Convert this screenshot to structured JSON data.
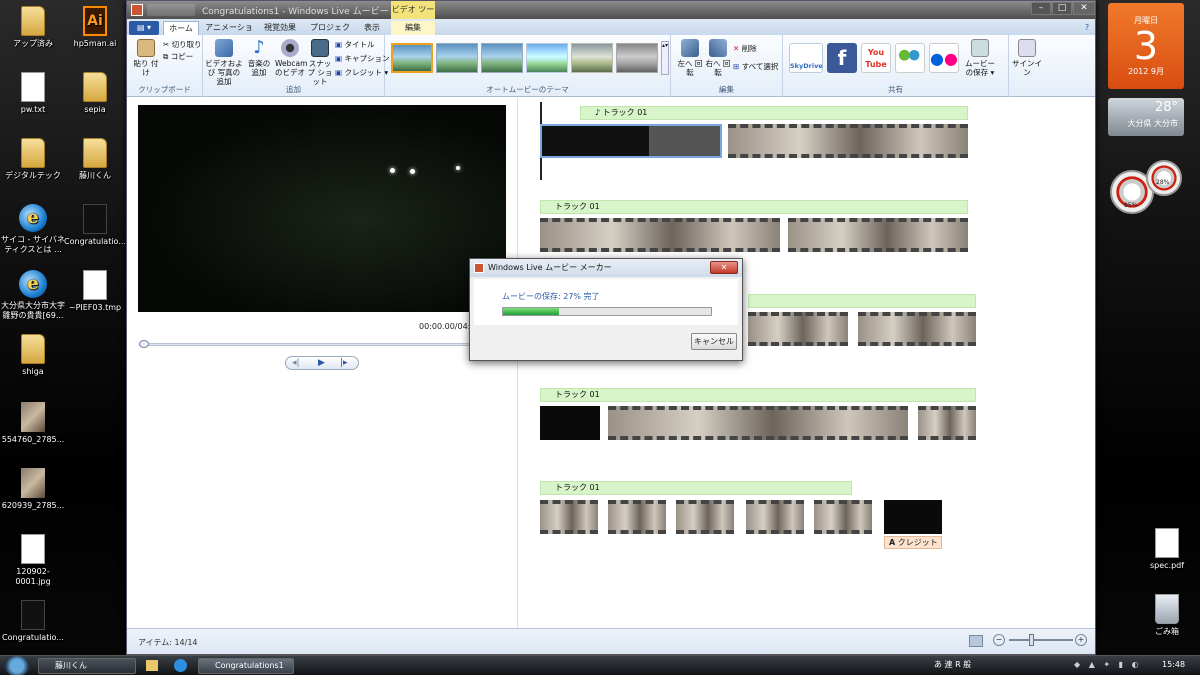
{
  "desktop": {
    "icons": [
      {
        "label": "アップ済み",
        "type": "folder"
      },
      {
        "label": "hp5man.ai",
        "type": "ai"
      },
      {
        "label": "pw.txt",
        "type": "doc"
      },
      {
        "label": "sepia",
        "type": "folder"
      },
      {
        "label": "デジタルテック",
        "type": "folder"
      },
      {
        "label": "藤川くん",
        "type": "folder"
      },
      {
        "label": "サイコ - サイバネ ティクスとは ...",
        "type": "ie"
      },
      {
        "label": "Congratulatio...",
        "type": "thumbdark"
      },
      {
        "label": "大分県大分市大字 雛野の貴貴[69...",
        "type": "ie"
      },
      {
        "label": "~PIEF03.tmp",
        "type": "doc"
      },
      {
        "label": "shiga",
        "type": "folder"
      },
      {
        "label": "554760_2785...",
        "type": "thumb"
      },
      {
        "label": "620939_2785...",
        "type": "thumb"
      },
      {
        "label": "120902-0001.jpg",
        "type": "doc"
      },
      {
        "label": "Congratulatio...",
        "type": "thumbdark"
      },
      {
        "label": "spec.pdf",
        "type": "doc"
      },
      {
        "label": "ごみ箱",
        "type": "doc"
      }
    ]
  },
  "window": {
    "title": "Congratulations1 - Windows Live ムービー メーカー",
    "tools_tab": "ビデオ ツール",
    "tabs": [
      "ホーム",
      "アニメーション",
      "視覚効果",
      "プロジェクト",
      "表示",
      "編集"
    ],
    "groups": {
      "clipboard": {
        "label": "クリップボード",
        "paste": "貼り 付け",
        "cut": "切り取り",
        "copy": "コピー"
      },
      "add": {
        "label": "追加",
        "video_photo": "ビデオおよび 写真の追加",
        "music": "音楽の 追加",
        "webcam": "Webcam のビデオ",
        "snapshot": "スナップ ショット",
        "title": "タイトル",
        "caption": "キャプション",
        "credit": "クレジット"
      },
      "themes": {
        "label": "オートムービーのテーマ"
      },
      "edit": {
        "label": "編集",
        "rotate_left": "左へ 回転",
        "rotate_right": "右へ 回転",
        "delete": "削除",
        "select_all": "すべて選択"
      },
      "share": {
        "label": "共有",
        "skydrive": "SkyDrive",
        "facebook": "f",
        "youtube": "You Tube",
        "save_movie": "ムービー の保存",
        "signin": "サインイン"
      }
    }
  },
  "player": {
    "time": "00:00.00/04:5",
    "seek_value": 0
  },
  "storyboard": {
    "tracks": [
      "♪ トラック 01",
      "トラック 01",
      "トラック 01",
      "トラック 01"
    ],
    "credit_label": "クレジット"
  },
  "status": {
    "items": "アイテム: 14/14"
  },
  "dialog": {
    "title": "Windows Live ムービー メーカー",
    "message": "ムービーの保存: 27% 完了",
    "progress": 0.27,
    "cancel": "キャンセル"
  },
  "taskbar": {
    "items": [
      "藤川くん",
      "Congratulations1 -..."
    ],
    "clock": "15:48",
    "ime": "あ 連 R 般"
  },
  "gadgets": {
    "calendar": {
      "weekday": "月曜日",
      "day": "3",
      "month": "2012 9月"
    },
    "weather": {
      "temp": "28°",
      "place": "大分県 大分市"
    },
    "meter1": "85%",
    "meter2": "28%"
  },
  "colors": {
    "accent": "#1f9e3a",
    "track_bg": "#d7f5c9"
  }
}
